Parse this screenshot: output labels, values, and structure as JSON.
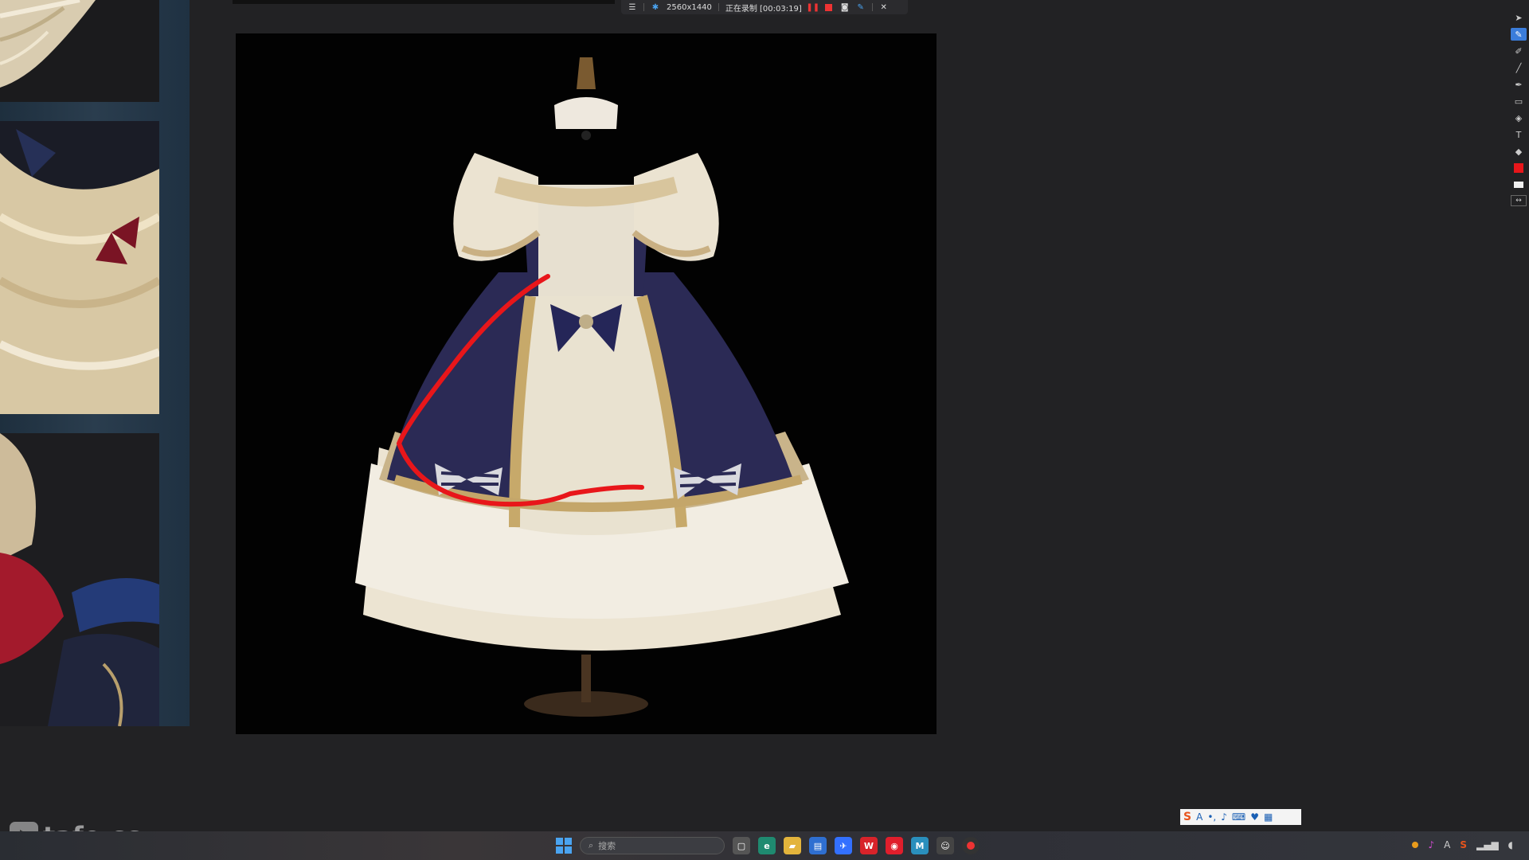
{
  "recorder": {
    "resolution": "2560x1440",
    "status": "正在录制 [00:03:19]"
  },
  "watermark": "tafe.cc",
  "taskbar": {
    "search_placeholder": "搜索",
    "tray_ime": "A"
  },
  "colors": {
    "annotation_stroke": "#e8161a",
    "active_tool": "#3b7ddb",
    "dress_navy": "#2b2a55",
    "dress_cream": "#e9e2d0"
  },
  "tools": [
    "cursor-icon",
    "pen-icon",
    "marker-icon",
    "line-icon",
    "brush-icon",
    "rectangle-icon",
    "fill-icon",
    "text-icon",
    "eraser-icon",
    "color-red",
    "color-white",
    "swap-icon"
  ]
}
